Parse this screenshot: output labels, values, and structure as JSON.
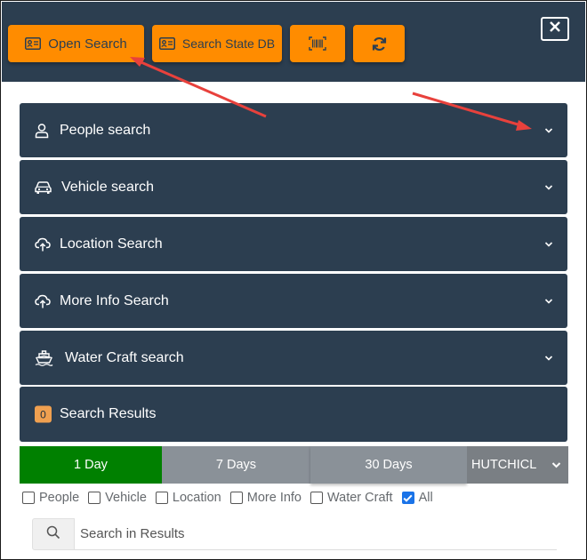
{
  "toolbar": {
    "open_search_label": "Open Search",
    "search_state_db_label": "Search State DB",
    "barcode_icon": "barcode-icon",
    "refresh_icon": "refresh-icon",
    "close_icon": "close-icon"
  },
  "panels": [
    {
      "icon": "person-icon",
      "title": "People search"
    },
    {
      "icon": "car-icon",
      "title": "Vehicle search"
    },
    {
      "icon": "cloud-upload-icon",
      "title": "Location Search"
    },
    {
      "icon": "cloud-upload-icon",
      "title": "More Info Search"
    },
    {
      "icon": "ship-icon",
      "title": "Water Craft search"
    }
  ],
  "results": {
    "count": "0",
    "title": "Search Results"
  },
  "range": {
    "options": [
      "1 Day",
      "7 Days",
      "30 Days"
    ],
    "selected": "1 Day",
    "user": "HUTCHICL"
  },
  "filters": [
    {
      "label": "People",
      "checked": false
    },
    {
      "label": "Vehicle",
      "checked": false
    },
    {
      "label": "Location",
      "checked": false
    },
    {
      "label": "More Info",
      "checked": false
    },
    {
      "label": "Water Craft",
      "checked": false
    },
    {
      "label": "All",
      "checked": true
    }
  ],
  "search": {
    "placeholder": "Search in Results",
    "value": ""
  },
  "colors": {
    "header_bg": "#2c3e50",
    "button_orange": "#ff8c00",
    "selected_green": "#008000",
    "inactive_gray": "#8a9198",
    "annotation_red": "#e8413c"
  }
}
